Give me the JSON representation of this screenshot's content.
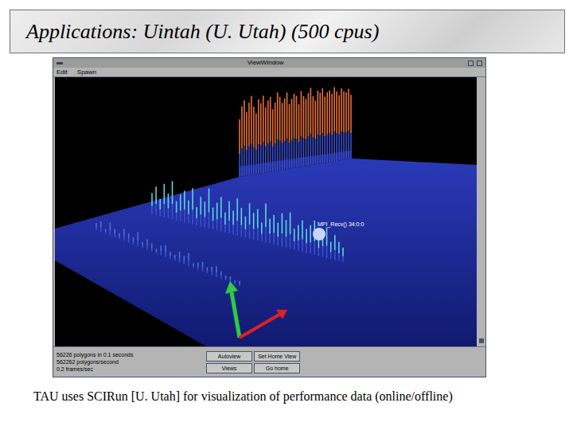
{
  "slide": {
    "title": "Applications: Uintah (U. Utah) (500 cpus)",
    "caption": "TAU uses SCIRun [U. Utah] for visualization of performance data (online/offline)"
  },
  "window": {
    "title": "ViewWindow",
    "menu": [
      "Edit",
      "Spawn"
    ]
  },
  "plot": {
    "pick_label": "MPI_Recv() 34:0:0",
    "series": [
      {
        "color": "#e8703a",
        "values": [
          72,
          88,
          95,
          80,
          91,
          99,
          85,
          76,
          93,
          88,
          97,
          82,
          90,
          94,
          78,
          86,
          98,
          92,
          84,
          89,
          96,
          81,
          87,
          93,
          90,
          79,
          95,
          88,
          84,
          91,
          97,
          86,
          80,
          92,
          89,
          94,
          83,
          88,
          90,
          85,
          93,
          87,
          82,
          90,
          86,
          84,
          88,
          80
        ]
      },
      {
        "color": "#5fd3e6",
        "values": [
          22,
          30,
          18,
          35,
          26,
          40,
          20,
          28,
          33,
          24,
          38,
          19,
          31,
          27,
          42,
          23,
          29,
          36,
          21,
          34,
          25,
          39,
          30,
          22,
          37,
          28,
          33,
          20,
          41,
          26,
          31,
          24,
          35,
          29,
          38,
          22,
          27,
          33,
          25,
          30,
          36,
          21,
          28,
          32,
          18,
          26,
          20,
          15
        ]
      },
      {
        "color": "#4a6fd8",
        "values": [
          6,
          9,
          4,
          11,
          7,
          5,
          10,
          8,
          6,
          12,
          5,
          9,
          7,
          4,
          8,
          10,
          6,
          5,
          9,
          7,
          11,
          4,
          6,
          8,
          5,
          7,
          9,
          6,
          4,
          5,
          3,
          4
        ]
      }
    ]
  },
  "status": [
    "56226 polygons in 0.1 seconds",
    "562262 polygons/second",
    "0.2 frames/sec"
  ],
  "buttons": [
    {
      "label": "Autoview"
    },
    {
      "label": "Set Home View"
    },
    {
      "label": "Views"
    },
    {
      "label": "Go home"
    }
  ]
}
